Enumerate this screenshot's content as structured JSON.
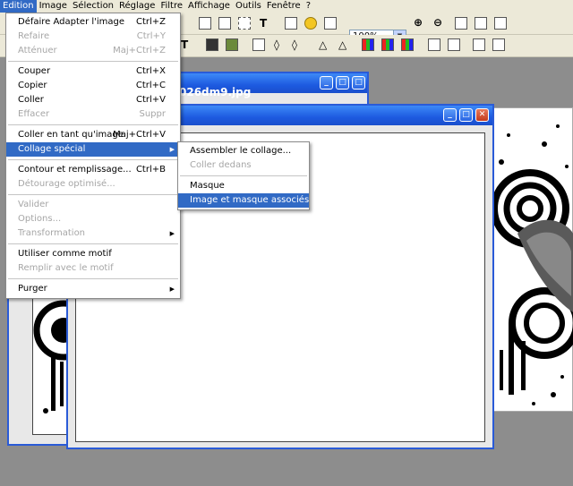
{
  "menubar": {
    "items": [
      "Edition",
      "Image",
      "Sélection",
      "Réglage",
      "Filtre",
      "Affichage",
      "Outils",
      "Fenêtre",
      "?"
    ]
  },
  "toolbar": {
    "zoom_value": "100%"
  },
  "windows": {
    "front_title": "",
    "back_title": "026dm9.jpg"
  },
  "edit_menu": {
    "items": [
      {
        "label": "Défaire Adapter l'image",
        "shortcut": "Ctrl+Z",
        "enabled": true
      },
      {
        "label": "Refaire",
        "shortcut": "Ctrl+Y",
        "enabled": false
      },
      {
        "label": "Atténuer",
        "shortcut": "Maj+Ctrl+Z",
        "enabled": false
      },
      {
        "label": "Couper",
        "shortcut": "Ctrl+X",
        "enabled": true
      },
      {
        "label": "Copier",
        "shortcut": "Ctrl+C",
        "enabled": true
      },
      {
        "label": "Coller",
        "shortcut": "Ctrl+V",
        "enabled": true
      },
      {
        "label": "Effacer",
        "shortcut": "Suppr",
        "enabled": false
      },
      {
        "label": "Coller en tant qu'image",
        "shortcut": "Maj+Ctrl+V",
        "enabled": true
      },
      {
        "label": "Collage spécial",
        "shortcut": "",
        "enabled": true
      },
      {
        "label": "Contour et remplissage...",
        "shortcut": "Ctrl+B",
        "enabled": true
      },
      {
        "label": "Détourage optimisé...",
        "shortcut": "",
        "enabled": false
      },
      {
        "label": "Valider",
        "shortcut": "",
        "enabled": false
      },
      {
        "label": "Options...",
        "shortcut": "",
        "enabled": false
      },
      {
        "label": "Transformation",
        "shortcut": "",
        "enabled": false
      },
      {
        "label": "Utiliser comme motif",
        "shortcut": "",
        "enabled": true
      },
      {
        "label": "Remplir avec le motif",
        "shortcut": "",
        "enabled": false
      },
      {
        "label": "Purger",
        "shortcut": "",
        "enabled": true
      }
    ]
  },
  "submenu": {
    "items": [
      {
        "label": "Assembler le collage...",
        "enabled": true
      },
      {
        "label": "Coller dedans",
        "enabled": false
      },
      {
        "label": "Masque",
        "enabled": true
      },
      {
        "label": "Image et masque associés",
        "enabled": true
      }
    ]
  },
  "colors": {
    "highlight": "#316ac5",
    "title_bar": "#1d5ae0",
    "menu_bg": "#ece9d8"
  }
}
